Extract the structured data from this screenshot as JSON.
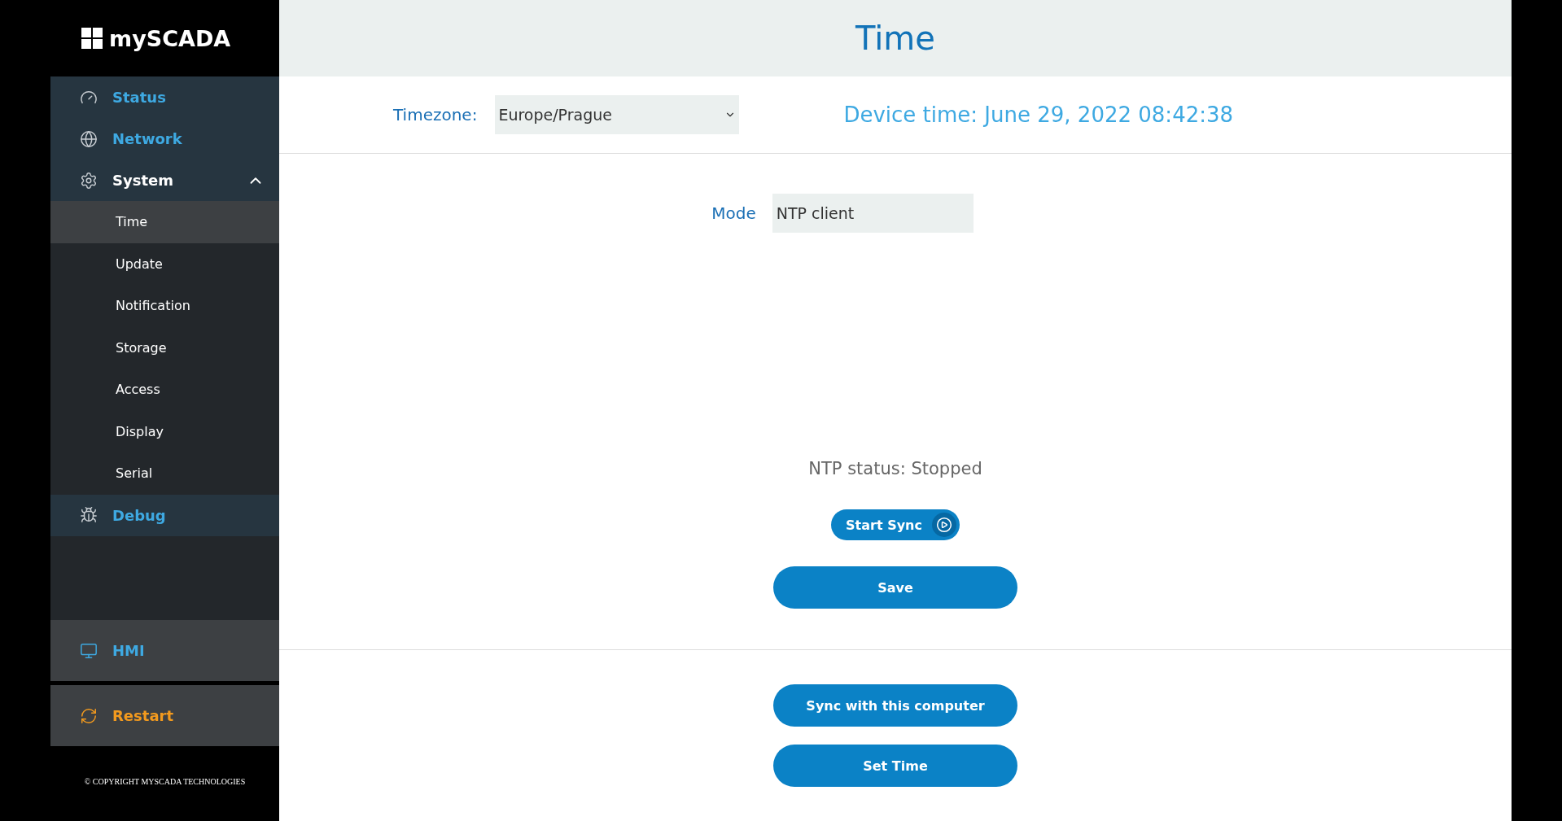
{
  "logo": {
    "text": "mySCADA"
  },
  "nav": [
    {
      "label": "Status"
    },
    {
      "label": "Network"
    },
    {
      "label": "System",
      "expanded": true,
      "children": [
        {
          "label": "Time",
          "selected": true
        },
        {
          "label": "Update",
          "selected": false
        },
        {
          "label": "Notification",
          "selected": false
        },
        {
          "label": "Storage",
          "selected": false
        },
        {
          "label": "Access",
          "selected": false
        },
        {
          "label": "Display",
          "selected": false
        },
        {
          "label": "Serial",
          "selected": false
        }
      ]
    },
    {
      "label": "Debug"
    }
  ],
  "bottom_nav": [
    {
      "label": "HMI"
    },
    {
      "label": "Restart"
    }
  ],
  "copyright": "© COPYRIGHT MYSCADA TECHNOLOGIES",
  "page_title": "Time",
  "timezone": {
    "label": "Timezone:",
    "value": "Europe/Prague"
  },
  "device_time": "Device time: June 29, 2022 08:42:38",
  "mode": {
    "label": "Mode",
    "value": "NTP client"
  },
  "ntp_status": "NTP status: Stopped",
  "start_sync": "Start Sync",
  "save": "Save",
  "buttons": [
    "Sync with this computer",
    "Set Time"
  ]
}
